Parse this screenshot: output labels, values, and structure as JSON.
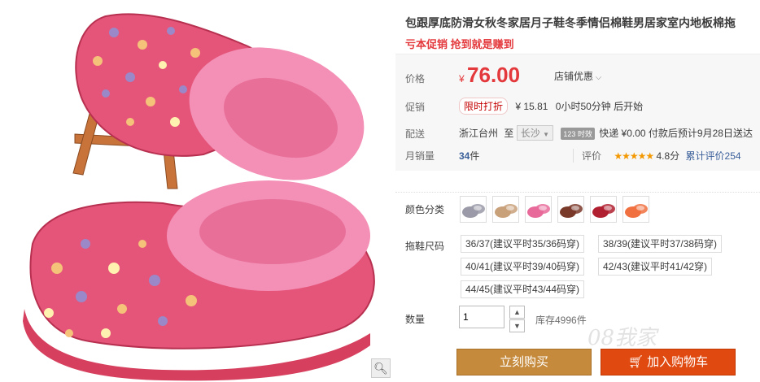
{
  "product": {
    "title": "包跟厚底防滑女秋冬家居月子鞋冬季情侣棉鞋男居家室内地板棉拖",
    "subtitle": "亏本促销 抢到就是赚到",
    "gallery_zoom_icon": "magnifier-icon"
  },
  "price": {
    "label": "价格",
    "currency": "¥",
    "value": "76.00",
    "shop_discount": "店铺优惠"
  },
  "promo": {
    "label": "促销",
    "tag": "限时打折",
    "currency": "¥",
    "value": "15.81",
    "countdown": "0小时50分钟 后开始"
  },
  "shipping": {
    "label": "配送",
    "from": "浙江台州",
    "to_word": "至",
    "dest": "长沙",
    "badge": "123 时效",
    "express": "快递 ¥0.00 付款后预计9月28日送达"
  },
  "sales": {
    "label": "月销量",
    "count": "34",
    "unit": "件",
    "rating_label": "评价",
    "stars": "★★★★★",
    "score": "4.8分",
    "reviews": "累计评价254"
  },
  "colors": {
    "label": "颜色分类",
    "swatches": [
      "#9a9aa8",
      "#c8a07a",
      "#e86a9a",
      "#7a3a2a",
      "#b02030",
      "#f07040"
    ]
  },
  "sizes": {
    "label": "拖鞋尺码",
    "options": [
      "36/37(建议平时35/36码穿)",
      "38/39(建议平时37/38码穿)",
      "40/41(建议平时39/40码穿)",
      "42/43(建议平时41/42穿)",
      "44/45(建议平时43/44码穿)"
    ]
  },
  "quantity": {
    "label": "数量",
    "value": "1",
    "stock": "库存4996件"
  },
  "actions": {
    "buy_now": "立刻购买",
    "add_to_cart": "加入购物车"
  },
  "watermark": "08我家"
}
